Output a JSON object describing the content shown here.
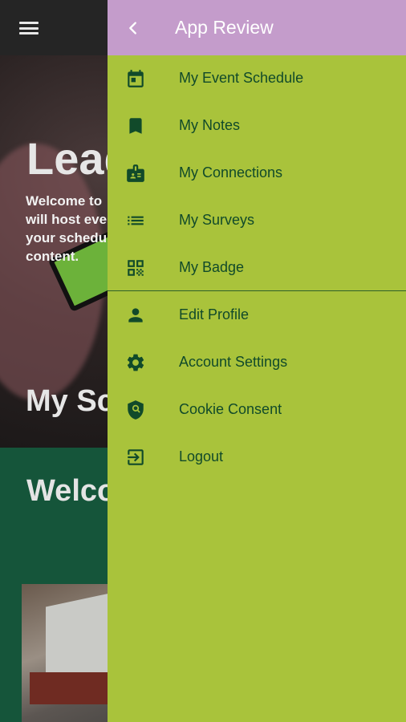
{
  "background": {
    "hero_title": "Lead",
    "hero_text": "Welcome to will host eve your schedu content.",
    "hero_lines": [
      "Welcome to",
      "will host eve",
      "your schedu",
      "content."
    ],
    "schedule_heading": "My Sc",
    "welcome_heading": "Welco"
  },
  "drawer": {
    "title": "App Review",
    "back_icon": "chevron-left-icon",
    "items": [
      {
        "label": "My Event Schedule",
        "icon": "calendar-icon"
      },
      {
        "label": "My Notes",
        "icon": "bookmark-icon"
      },
      {
        "label": "My Connections",
        "icon": "contact-card-icon"
      },
      {
        "label": "My Surveys",
        "icon": "list-icon"
      },
      {
        "label": "My Badge",
        "icon": "qr-code-icon"
      },
      {
        "label": "Edit Profile",
        "icon": "person-icon"
      },
      {
        "label": "Account Settings",
        "icon": "gear-icon"
      },
      {
        "label": "Cookie Consent",
        "icon": "shield-search-icon"
      },
      {
        "label": "Logout",
        "icon": "logout-icon"
      }
    ]
  },
  "colors": {
    "drawer_bg": "#a9c33b",
    "drawer_header": "#c49ccb",
    "icon_text": "#114a2a",
    "welcome_bg": "#15553a"
  }
}
